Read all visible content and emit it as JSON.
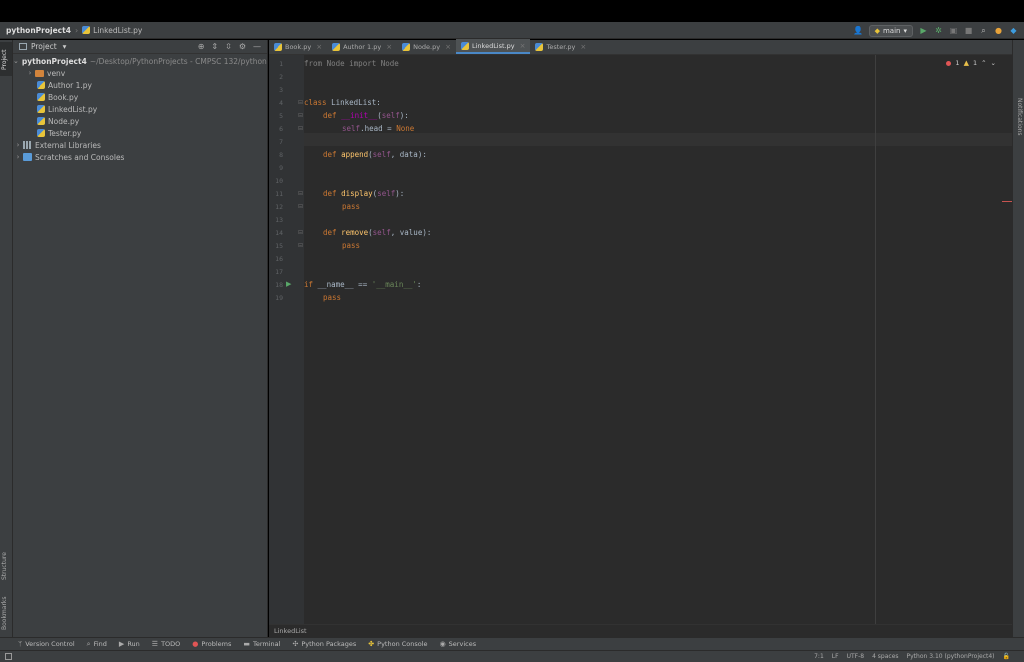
{
  "navbar": {
    "project": "pythonProject4",
    "file": "LinkedList.py",
    "branch": "main"
  },
  "left_strip": {
    "project": "Project",
    "structure": "Structure",
    "bookmarks": "Bookmarks"
  },
  "right_strip": {
    "notifications": "Notifications"
  },
  "project_panel": {
    "title": "Project",
    "tree": [
      {
        "label": "pythonProject4",
        "path": "~/Desktop/PythonProjects - CMPSC 132/pythonProject4"
      },
      {
        "label": "venv"
      },
      {
        "label": "Author 1.py"
      },
      {
        "label": "Book.py"
      },
      {
        "label": "LinkedList.py"
      },
      {
        "label": "Node.py"
      },
      {
        "label": "Tester.py"
      },
      {
        "label": "External Libraries"
      },
      {
        "label": "Scratches and Consoles"
      }
    ]
  },
  "tabs": [
    {
      "label": "Book.py"
    },
    {
      "label": "Author 1.py"
    },
    {
      "label": "Node.py"
    },
    {
      "label": "LinkedList.py"
    },
    {
      "label": "Tester.py"
    }
  ],
  "inspections": {
    "errors": "1",
    "warnings": "1"
  },
  "code": {
    "l1": {
      "a": "from",
      "b": " Node ",
      "c": "import",
      "d": " Node"
    },
    "l4": {
      "a": "class",
      "b": " LinkedList:"
    },
    "l5": {
      "a": "def ",
      "b": "__init__",
      "c": "(",
      "d": "self",
      "e": "):"
    },
    "l6": {
      "a": "self",
      "b": ".head = ",
      "c": "None"
    },
    "l8": {
      "a": "def ",
      "b": "append",
      "c": "(",
      "d": "self",
      "e": ", data):"
    },
    "l11": {
      "a": "def ",
      "b": "display",
      "c": "(",
      "d": "self",
      "e": "):"
    },
    "l12": {
      "a": "pass"
    },
    "l14": {
      "a": "def ",
      "b": "remove",
      "c": "(",
      "d": "self",
      "e": ", value):"
    },
    "l15": {
      "a": "pass"
    },
    "l18": {
      "a": "if",
      "b": " __name__ == ",
      "c": "'__main__'",
      "d": ":"
    },
    "l19": {
      "a": "pass"
    }
  },
  "line_numbers": [
    "1",
    "2",
    "3",
    "4",
    "5",
    "6",
    "7",
    "8",
    "9",
    "10",
    "11",
    "12",
    "13",
    "14",
    "15",
    "16",
    "17",
    "18",
    "19"
  ],
  "breadcrumb": "LinkedList",
  "tool_windows": [
    {
      "label": "Version Control"
    },
    {
      "label": "Find"
    },
    {
      "label": "Run"
    },
    {
      "label": "TODO"
    },
    {
      "label": "Problems"
    },
    {
      "label": "Terminal"
    },
    {
      "label": "Python Packages"
    },
    {
      "label": "Python Console"
    },
    {
      "label": "Services"
    }
  ],
  "status": {
    "position": "7:1",
    "line_sep": "LF",
    "encoding": "UTF-8",
    "indent": "4 spaces",
    "interpreter": "Python 3.10 (pythonProject4)"
  }
}
